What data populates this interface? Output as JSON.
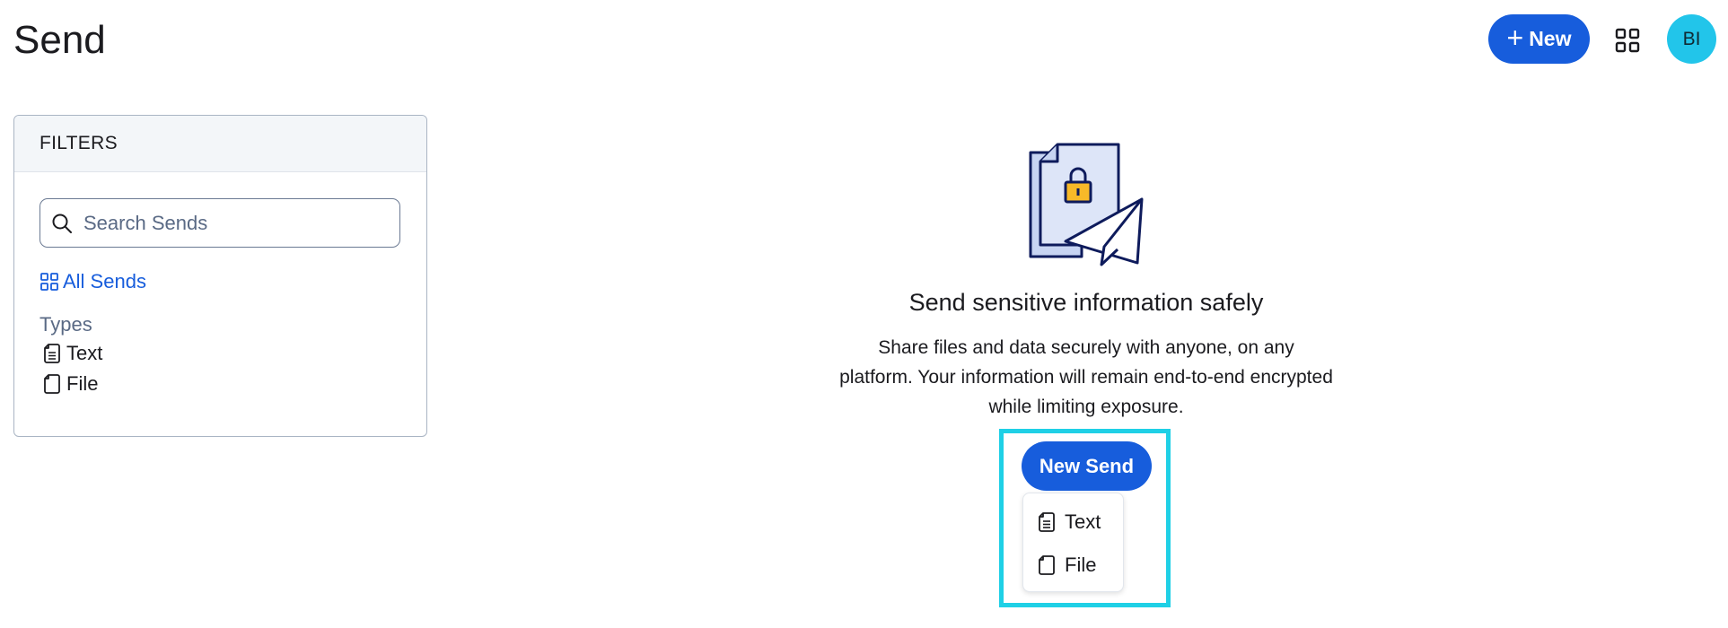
{
  "header": {
    "title": "Send",
    "new_button_plus": "+",
    "new_button_label": "New",
    "apps_icon": "grid-icon",
    "avatar_initials": "BI"
  },
  "filters": {
    "title": "FILTERS",
    "search": {
      "placeholder": "Search Sends",
      "value": ""
    },
    "all_sends_label": "All Sends",
    "types_heading": "Types",
    "types": [
      {
        "label": "Text",
        "icon": "text-file-icon"
      },
      {
        "label": "File",
        "icon": "file-icon"
      }
    ]
  },
  "empty_state": {
    "title": "Send sensitive information safely",
    "description": "Share files and data securely with anyone, on any platform. Your information will remain end-to-end encrypted while limiting exposure.",
    "new_send_label": "New Send",
    "menu": [
      {
        "label": "Text",
        "icon": "text-file-icon"
      },
      {
        "label": "File",
        "icon": "file-icon"
      }
    ]
  },
  "colors": {
    "primary": "#175ddc",
    "avatar": "#22c5ea",
    "highlight": "#1fd0e6",
    "muted": "#5a6a85"
  }
}
